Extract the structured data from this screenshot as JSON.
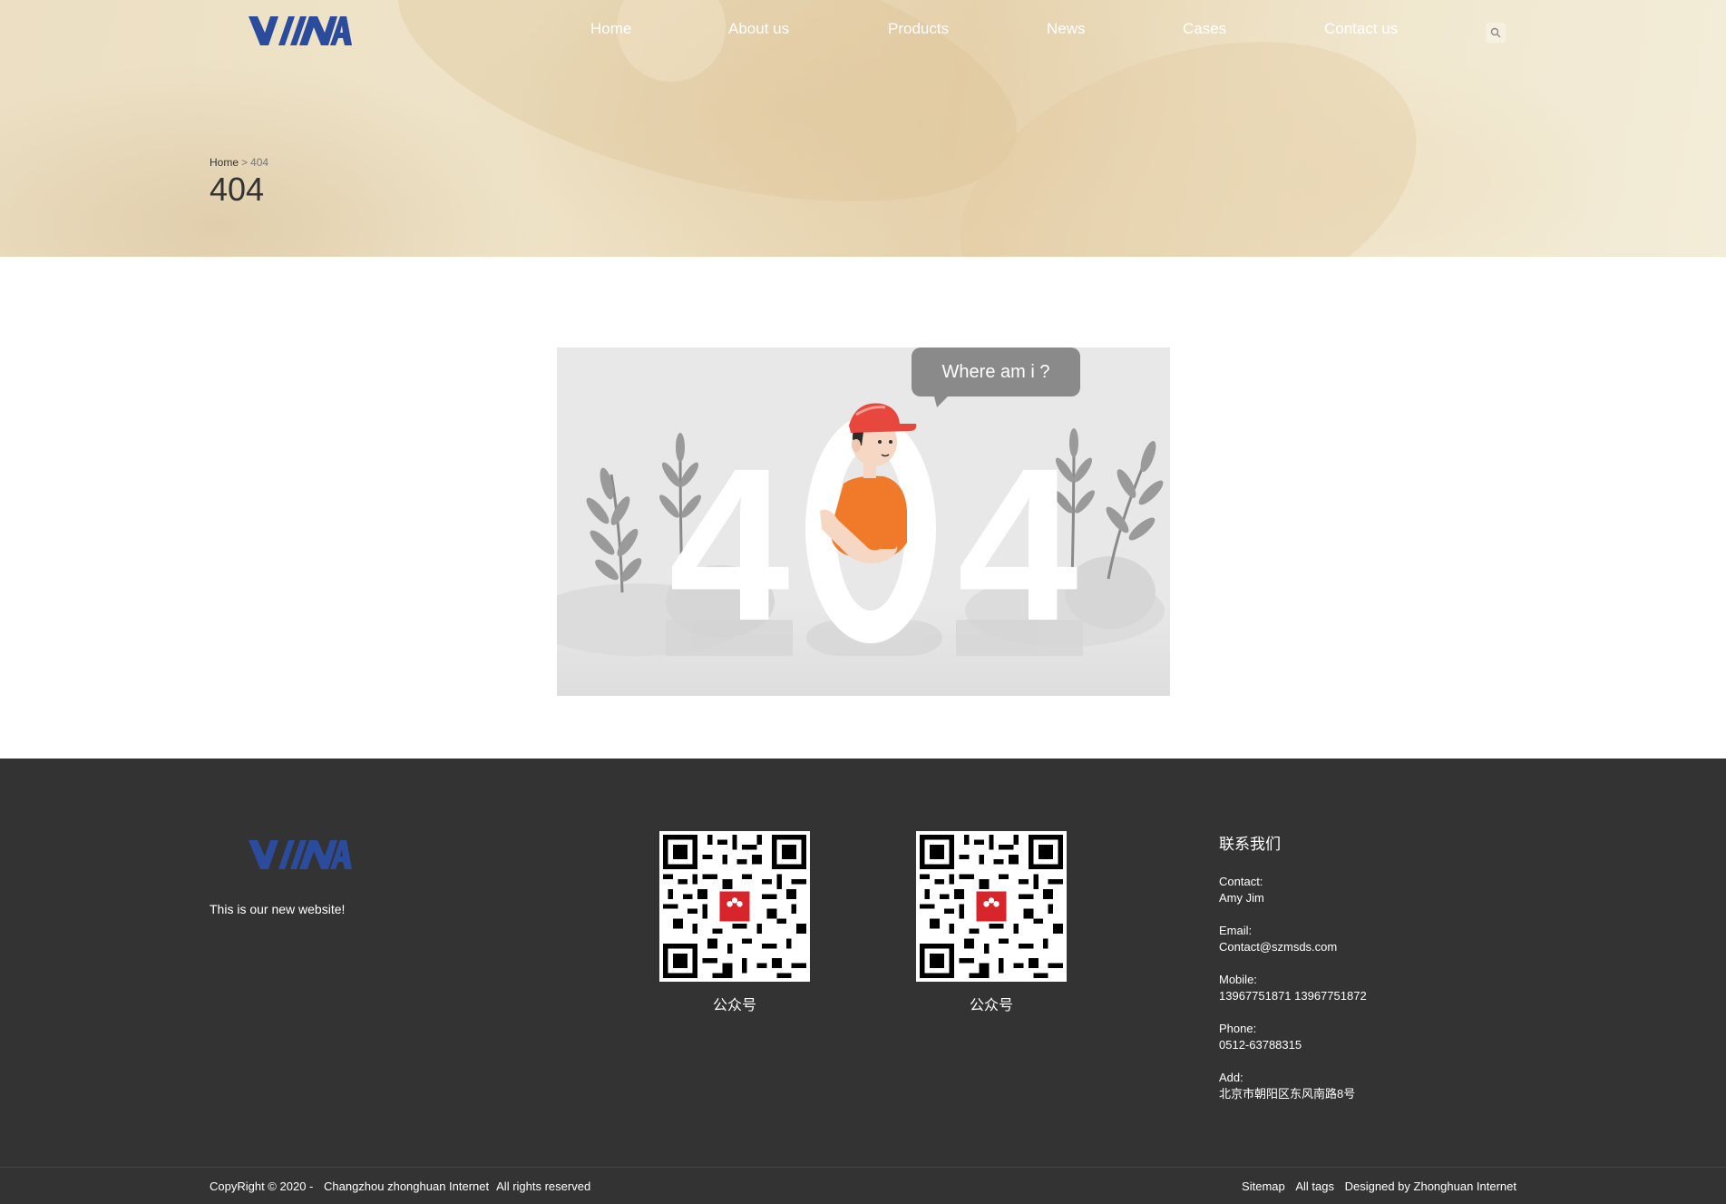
{
  "header": {
    "logo_text": "YIMA",
    "nav": [
      {
        "label": "Home"
      },
      {
        "label": "About us"
      },
      {
        "label": "Products"
      },
      {
        "label": "News"
      },
      {
        "label": "Cases"
      },
      {
        "label": "Contact us"
      }
    ],
    "search_icon": "search-icon"
  },
  "banner": {
    "breadcrumb": {
      "home": "Home",
      "separator": ">",
      "current": "404"
    },
    "title": "404"
  },
  "error": {
    "bubble_text": "Where am i ?",
    "big_digits": [
      "4",
      "0",
      "4"
    ],
    "colors": {
      "background": "#e8e8e8",
      "digits": "#ffffff",
      "cap": "#e8473e",
      "shirt": "#f07a2a",
      "bubble": "#8a8a8a"
    }
  },
  "footer": {
    "logo_text": "YIMA",
    "tagline": "This is our new website!",
    "qr_codes": [
      {
        "label": "公众号"
      },
      {
        "label": "公众号"
      }
    ],
    "contact": {
      "heading": "联系我们",
      "contact_label": "Contact:",
      "contact_value": "Amy  Jim",
      "email_label": "Email:",
      "email_value": "Contact@szmsds.com",
      "mobile_label": "Mobile:",
      "mobile_value": "13967751871  13967751872",
      "phone_label": "Phone:",
      "phone_value": "0512-63788315",
      "add_label": "Add:",
      "add_value": "北京市朝阳区东风南路8号"
    },
    "copyright": {
      "prefix": "CopyRight © 2020 -",
      "company": "Changzhou zhonghuan Internet",
      "rights": "All rights reserved"
    },
    "links": [
      "Sitemap",
      "All tags",
      "Designed by Zhonghuan Internet"
    ]
  },
  "colors": {
    "brand_blue": "#2b4c9c",
    "footer_bg": "#333333",
    "hero_tint": "#ecdfc3"
  }
}
